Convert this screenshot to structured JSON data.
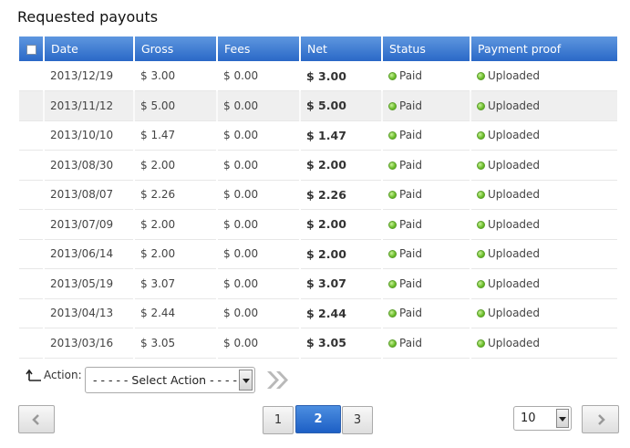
{
  "title": "Requested payouts",
  "columns": [
    "Date",
    "Gross",
    "Fees",
    "Net",
    "Status",
    "Payment proof"
  ],
  "rows": [
    {
      "date": "2013/12/19",
      "gross": "$ 3.00",
      "fees": "$ 0.00",
      "net": "$ 3.00",
      "status": "Paid",
      "proof": "Uploaded"
    },
    {
      "date": "2013/11/12",
      "gross": "$ 5.00",
      "fees": "$ 0.00",
      "net": "$ 5.00",
      "status": "Paid",
      "proof": "Uploaded"
    },
    {
      "date": "2013/10/10",
      "gross": "$ 1.47",
      "fees": "$ 0.00",
      "net": "$ 1.47",
      "status": "Paid",
      "proof": "Uploaded"
    },
    {
      "date": "2013/08/30",
      "gross": "$ 2.00",
      "fees": "$ 0.00",
      "net": "$ 2.00",
      "status": "Paid",
      "proof": "Uploaded"
    },
    {
      "date": "2013/08/07",
      "gross": "$ 2.26",
      "fees": "$ 0.00",
      "net": "$ 2.26",
      "status": "Paid",
      "proof": "Uploaded"
    },
    {
      "date": "2013/07/09",
      "gross": "$ 2.00",
      "fees": "$ 0.00",
      "net": "$ 2.00",
      "status": "Paid",
      "proof": "Uploaded"
    },
    {
      "date": "2013/06/14",
      "gross": "$ 2.00",
      "fees": "$ 0.00",
      "net": "$ 2.00",
      "status": "Paid",
      "proof": "Uploaded"
    },
    {
      "date": "2013/05/19",
      "gross": "$ 3.07",
      "fees": "$ 0.00",
      "net": "$ 3.07",
      "status": "Paid",
      "proof": "Uploaded"
    },
    {
      "date": "2013/04/13",
      "gross": "$ 2.44",
      "fees": "$ 0.00",
      "net": "$ 2.44",
      "status": "Paid",
      "proof": "Uploaded"
    },
    {
      "date": "2013/03/16",
      "gross": "$ 3.05",
      "fees": "$ 0.00",
      "net": "$ 3.05",
      "status": "Paid",
      "proof": "Uploaded"
    }
  ],
  "highlighted_row": 1,
  "action": {
    "label": "Action:",
    "selected": "- - - - - Select Action - - - - -"
  },
  "pagination": {
    "prev_icon": "chevron-left-icon",
    "next_icon": "chevron-right-icon",
    "pages": [
      "1",
      "2",
      "3"
    ],
    "current": "2"
  },
  "per_page": {
    "selected": "10"
  },
  "colors": {
    "header_top": "#5e97df",
    "header_bottom": "#2a68c7",
    "status_dot": "#6bbd2a",
    "active_page": "#1d5fc5"
  }
}
